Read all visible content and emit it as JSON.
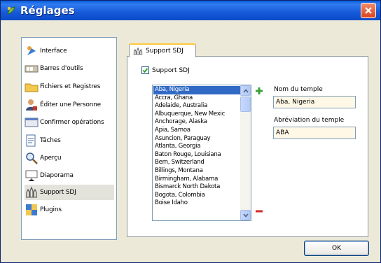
{
  "window": {
    "title": "Réglages"
  },
  "nav": {
    "items": [
      {
        "label": "Interface",
        "icon": "interface-icon"
      },
      {
        "label": "Barres d'outils",
        "icon": "toolbar-icon"
      },
      {
        "label": "Fichiers et Registres",
        "icon": "folder-icon"
      },
      {
        "label": "Éditer une Personne",
        "icon": "person-icon"
      },
      {
        "label": "Confirmer opérations",
        "icon": "confirm-icon"
      },
      {
        "label": "Tâches",
        "icon": "tasks-icon"
      },
      {
        "label": "Aperçu",
        "icon": "preview-icon"
      },
      {
        "label": "Diaporama",
        "icon": "slideshow-icon"
      },
      {
        "label": "Support SDJ",
        "icon": "temple-icon",
        "selected": true
      },
      {
        "label": "Plugins",
        "icon": "plugins-icon"
      }
    ]
  },
  "tab": {
    "label": "Support SDJ"
  },
  "checkbox": {
    "label": "Support SDJ",
    "checked": true
  },
  "temples": [
    "Aba, Nigeria",
    "Accra, Ghana",
    "Adelaide, Australia",
    "Albuquerque, New Mexic",
    "Anchorage, Alaska",
    "Apia, Samoa",
    "Asuncion, Paraguay",
    "Atlanta, Georgia",
    "Baton Rouge, Louisiana",
    "Bern, Switzerland",
    "Billings, Montana",
    "Birmingham, Alabama",
    "Bismarck North Dakota",
    "Bogota, Colombia",
    "Boise Idaho"
  ],
  "selected_temple_index": 0,
  "fields": {
    "name_label": "Nom du temple",
    "name_value": "Aba, Nigeria",
    "abbr_label": "Abréviation du temple",
    "abbr_value": "ABA"
  },
  "ok_label": "OK",
  "colors": {
    "title_bar": "#1659D8",
    "selection": "#316AC5",
    "add": "#3CA03C",
    "remove": "#D22A2A"
  }
}
